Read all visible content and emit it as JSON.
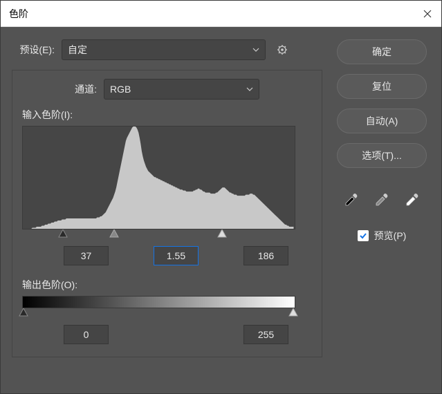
{
  "dialog": {
    "title": "色阶"
  },
  "preset": {
    "label": "预设(E):",
    "value": "自定"
  },
  "channel": {
    "label": "通道:",
    "value": "RGB"
  },
  "input_levels": {
    "label": "输入色阶(I):",
    "shadow": "37",
    "midtone": "1.55",
    "highlight": "186"
  },
  "output_levels": {
    "label": "输出色阶(O):",
    "black": "0",
    "white": "255"
  },
  "buttons": {
    "ok": "确定",
    "reset": "复位",
    "auto": "自动(A)",
    "options": "选项(T)..."
  },
  "preview": {
    "label": "预览(P)",
    "checked": true
  },
  "chart_data": {
    "type": "histogram",
    "title": "输入色阶",
    "xlabel": "",
    "ylabel": "",
    "xlim": [
      0,
      255
    ],
    "values": [
      0,
      0,
      0,
      0,
      0,
      0,
      0,
      0,
      0,
      1,
      1,
      1,
      1,
      2,
      2,
      2,
      2,
      2,
      3,
      3,
      3,
      4,
      4,
      4,
      5,
      5,
      5,
      6,
      6,
      6,
      7,
      7,
      7,
      8,
      8,
      8,
      8,
      9,
      9,
      9,
      9,
      10,
      10,
      10,
      10,
      10,
      10,
      10,
      10,
      10,
      10,
      10,
      10,
      10,
      10,
      10,
      10,
      10,
      10,
      10,
      10,
      10,
      10,
      10,
      10,
      10,
      10,
      10,
      10,
      10,
      11,
      11,
      11,
      12,
      12,
      13,
      14,
      15,
      16,
      18,
      20,
      22,
      24,
      26,
      28,
      30,
      33,
      36,
      40,
      45,
      50,
      55,
      60,
      65,
      70,
      75,
      80,
      85,
      88,
      90,
      92,
      94,
      96,
      98,
      99,
      99,
      99,
      98,
      96,
      93,
      88,
      82,
      75,
      70,
      66,
      63,
      60,
      58,
      56,
      55,
      54,
      53,
      52,
      51,
      50,
      50,
      49,
      49,
      48,
      48,
      47,
      47,
      46,
      46,
      45,
      45,
      44,
      44,
      43,
      43,
      42,
      42,
      41,
      41,
      40,
      40,
      39,
      39,
      38,
      38,
      38,
      37,
      37,
      37,
      36,
      36,
      36,
      36,
      36,
      36,
      36,
      37,
      37,
      38,
      38,
      39,
      39,
      38,
      38,
      37,
      36,
      36,
      35,
      35,
      35,
      35,
      35,
      34,
      34,
      34,
      34,
      34,
      35,
      35,
      36,
      37,
      38,
      39,
      40,
      40,
      40,
      39,
      38,
      37,
      36,
      35,
      35,
      34,
      34,
      33,
      33,
      33,
      32,
      32,
      32,
      32,
      32,
      32,
      32,
      32,
      33,
      33,
      33,
      33,
      34,
      34,
      34,
      33,
      33,
      32,
      31,
      30,
      29,
      28,
      27,
      26,
      25,
      24,
      23,
      22,
      21,
      20,
      19,
      18,
      17,
      16,
      15,
      14,
      13,
      12,
      11,
      10,
      9,
      8,
      7,
      6,
      5,
      4,
      4,
      3,
      3,
      2,
      2,
      2,
      2,
      2
    ]
  }
}
